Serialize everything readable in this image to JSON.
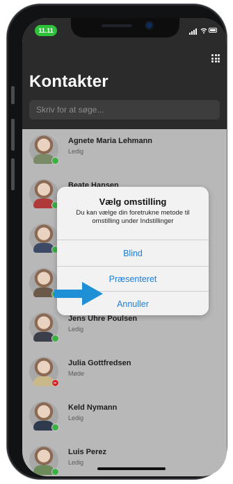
{
  "status_bar": {
    "time": "11.11",
    "time_pill_color": "#2ec13a"
  },
  "header": {
    "title": "Kontakter",
    "dialpad_icon": "keypad-grid-icon"
  },
  "search": {
    "placeholder": "Skriv for at søge..."
  },
  "contacts": [
    {
      "name": "Agnete Maria Lehmann",
      "status": "Ledig",
      "presence": "available"
    },
    {
      "name": "Beate Hansen",
      "status": "",
      "presence": "available"
    },
    {
      "name": "",
      "status": "",
      "presence": "available"
    },
    {
      "name": "",
      "status": "",
      "presence": "available"
    },
    {
      "name": "Jens Uhre Poulsen",
      "status": "Ledig",
      "presence": "available"
    },
    {
      "name": "Julia Gottfredsen",
      "status": "Møde",
      "presence": "busy"
    },
    {
      "name": "Keld Nymann",
      "status": "Ledig",
      "presence": "available"
    },
    {
      "name": "Luis Perez",
      "status": "Ledig",
      "presence": "available"
    }
  ],
  "dialog": {
    "title": "Vælg omstilling",
    "message": "Du kan vælge din foretrukne metode til omstilling under Indstillinger",
    "options": [
      "Blind",
      "Præsenteret",
      "Annuller"
    ]
  },
  "colors": {
    "header_bg": "#2b2b2b",
    "list_dimmed_bg": "#b8b8b8",
    "available_dot": "#3cb043",
    "busy_dot": "#d9262b",
    "dialog_button_text": "#1b7fe0",
    "arrow": "#1f8fd6"
  }
}
